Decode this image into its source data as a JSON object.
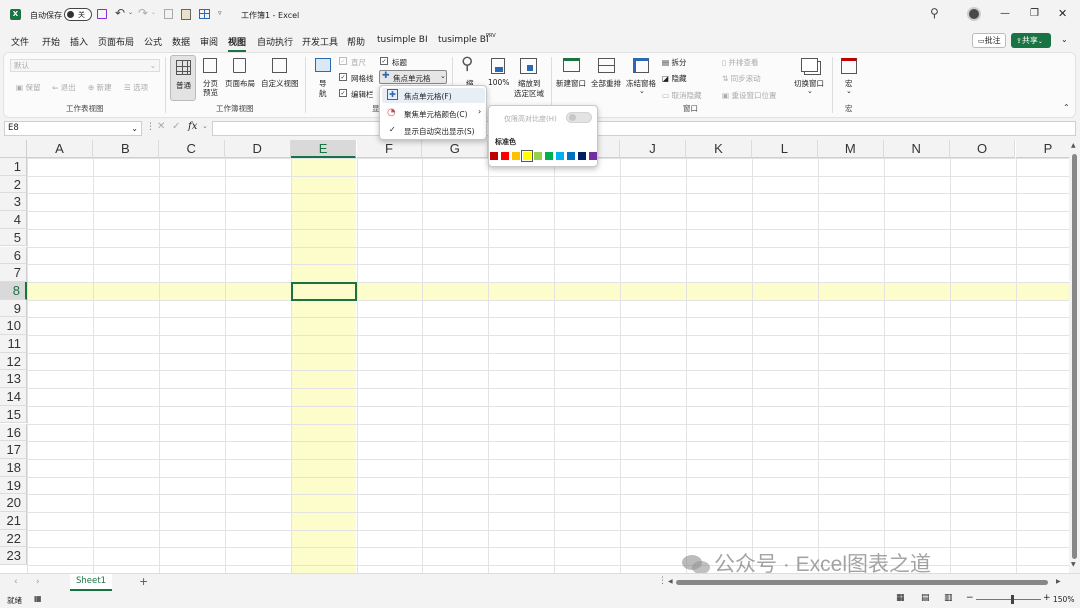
{
  "titlebar": {
    "autosave_label": "自动保存",
    "autosave_state": "关",
    "document_title": "工作簿1 - Excel"
  },
  "menu": [
    "文件",
    "开始",
    "插入",
    "页面布局",
    "公式",
    "数据",
    "审阅",
    "视图",
    "自动执行",
    "开发工具",
    "帮助",
    "tusimple BI",
    "tusimple BI"
  ],
  "menu_active_index": 7,
  "menu_suffix": "PRV",
  "comments_button": "批注",
  "share_button": "共享",
  "ribbon": {
    "sheet_view": {
      "dropdown": "默认",
      "keep": "保留",
      "exit": "退出",
      "new": "新建",
      "options": "选项",
      "label": "工作表视图"
    },
    "workbook_views": {
      "normal": "普通",
      "page_break_1": "分页",
      "page_break_2": "预览",
      "page_layout": "页面布局",
      "custom": "自定义视图",
      "label": "工作簿视图"
    },
    "show": {
      "nav_1": "导",
      "nav_2": "航",
      "ruler": "直尺",
      "gridlines": "网格线",
      "formula_bar": "编辑栏",
      "headings": "标题",
      "focus_cell": "焦点单元格",
      "label": "显"
    },
    "zoom": {
      "zoom_1": "缩",
      "zoom_2": "放",
      "hundred": "100%",
      "to_selection_1": "缩放到",
      "to_selection_2": "选定区域"
    },
    "window": {
      "new_window": "新建窗口",
      "arrange_all": "全部重排",
      "freeze_panes": "冻结窗格",
      "split": "拆分",
      "hide": "隐藏",
      "unhide": "取消隐藏",
      "side_by_side": "并排查看",
      "sync_scroll": "同步滚动",
      "reset_position": "重设窗口位置",
      "label": "窗口"
    },
    "switch_windows": "切换窗口",
    "macros": {
      "text": "宏",
      "label": "宏"
    }
  },
  "focus_menu": {
    "item1": "焦点单元格(F)",
    "item2": "聚焦单元格颜色(C)",
    "item3": "显示自动突出显示(S)"
  },
  "color_submenu": {
    "toggle_label": "仅限高对比度(H)",
    "standard_colors_label": "标准色",
    "colors": [
      "#c00000",
      "#ff0000",
      "#ffc000",
      "#ffff00",
      "#92d050",
      "#00b050",
      "#00b0f0",
      "#0070c0",
      "#002060",
      "#7030a0"
    ],
    "selected_index": 3
  },
  "formula_bar": {
    "name_box": "E8",
    "fx": "fx"
  },
  "grid": {
    "columns": [
      "A",
      "B",
      "C",
      "D",
      "E",
      "F",
      "G",
      "H",
      "I",
      "J",
      "K",
      "L",
      "M",
      "N",
      "O",
      "P"
    ],
    "rows": [
      "1",
      "2",
      "3",
      "4",
      "5",
      "6",
      "7",
      "8",
      "9",
      "10",
      "11",
      "12",
      "13",
      "14",
      "15",
      "16",
      "17",
      "18",
      "19",
      "20",
      "21",
      "22",
      "23"
    ],
    "selected_column": 4,
    "selected_row": 7,
    "highlight_color": "#fdfccb",
    "accent_color": "#1a7343"
  },
  "sheet_tab": "Sheet1",
  "status": {
    "ready": "就绪",
    "zoom": "150%"
  },
  "watermark": "公众号 · Excel图表之道"
}
